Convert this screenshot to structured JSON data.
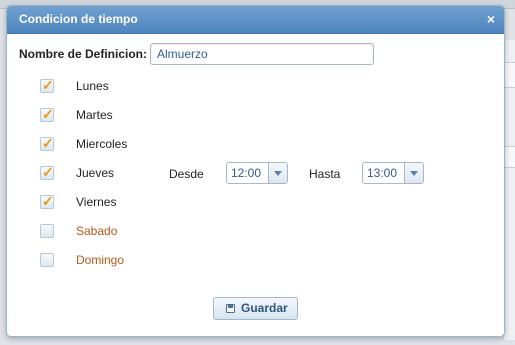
{
  "dialog": {
    "title": "Condicion de tiempo",
    "close_symbol": "×",
    "name_label": "Nombre de Definicion:",
    "name_value": "Almuerzo",
    "days": [
      {
        "label": "Lunes",
        "checked": true
      },
      {
        "label": "Martes",
        "checked": true
      },
      {
        "label": "Miercoles",
        "checked": true
      },
      {
        "label": "Jueves",
        "checked": true
      },
      {
        "label": "Viernes",
        "checked": true
      },
      {
        "label": "Sabado",
        "checked": false
      },
      {
        "label": "Domingo",
        "checked": false
      }
    ],
    "from_label": "Desde",
    "from_value": "12:00",
    "to_label": "Hasta",
    "to_value": "13:00",
    "save_label": "Guardar"
  },
  "colors": {
    "titlebar": "#4f86bf",
    "weekend_label": "#b8581a",
    "checkmark": "#e99a13"
  }
}
